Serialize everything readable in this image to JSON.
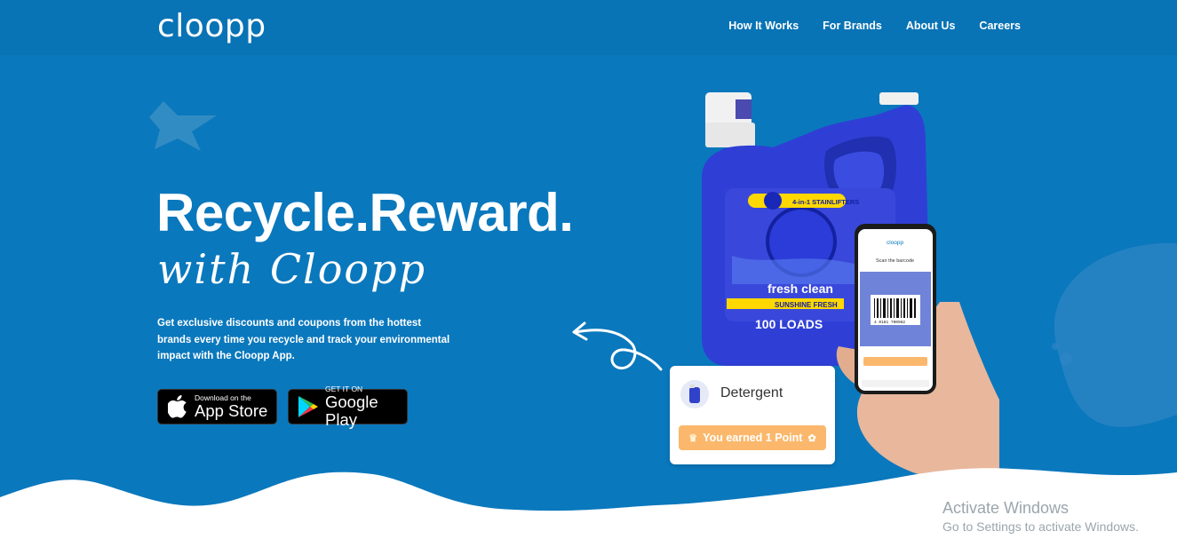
{
  "brand": {
    "logo": "cloopp"
  },
  "nav": [
    {
      "label": "How It Works"
    },
    {
      "label": "For Brands"
    },
    {
      "label": "About Us"
    },
    {
      "label": "Careers"
    }
  ],
  "hero": {
    "title": "Recycle.Reward.",
    "subtitle": "with Cloopp",
    "description": "Get exclusive discounts and coupons from the hottest brands every time you recycle and track your environmental impact with the Cloopp App."
  },
  "stores": {
    "apple": {
      "small": "Download on the",
      "big": "App Store"
    },
    "google": {
      "small": "GET IT ON",
      "big": "Google Play"
    }
  },
  "product": {
    "label_brand": "fresh clean",
    "label_scent": "SUNSHINE FRESH",
    "label_loads": "100 LOADS",
    "label_badge": "4-in-1 STAINLIFTERS"
  },
  "phone": {
    "app_name": "cloopp",
    "instruction": "Scan the barcode",
    "barcode_number": "4 0181 700982"
  },
  "notification": {
    "product_name": "Detergent",
    "earned": "You earned 1 Point"
  },
  "watermark": {
    "line1": "Activate Windows",
    "line2": "Go to Settings to activate Windows."
  },
  "colors": {
    "background": "#0a78bd",
    "topbar": "#0873b5",
    "accent_orange": "#fbb86c",
    "bottle_blue": "#2f3fd6"
  }
}
